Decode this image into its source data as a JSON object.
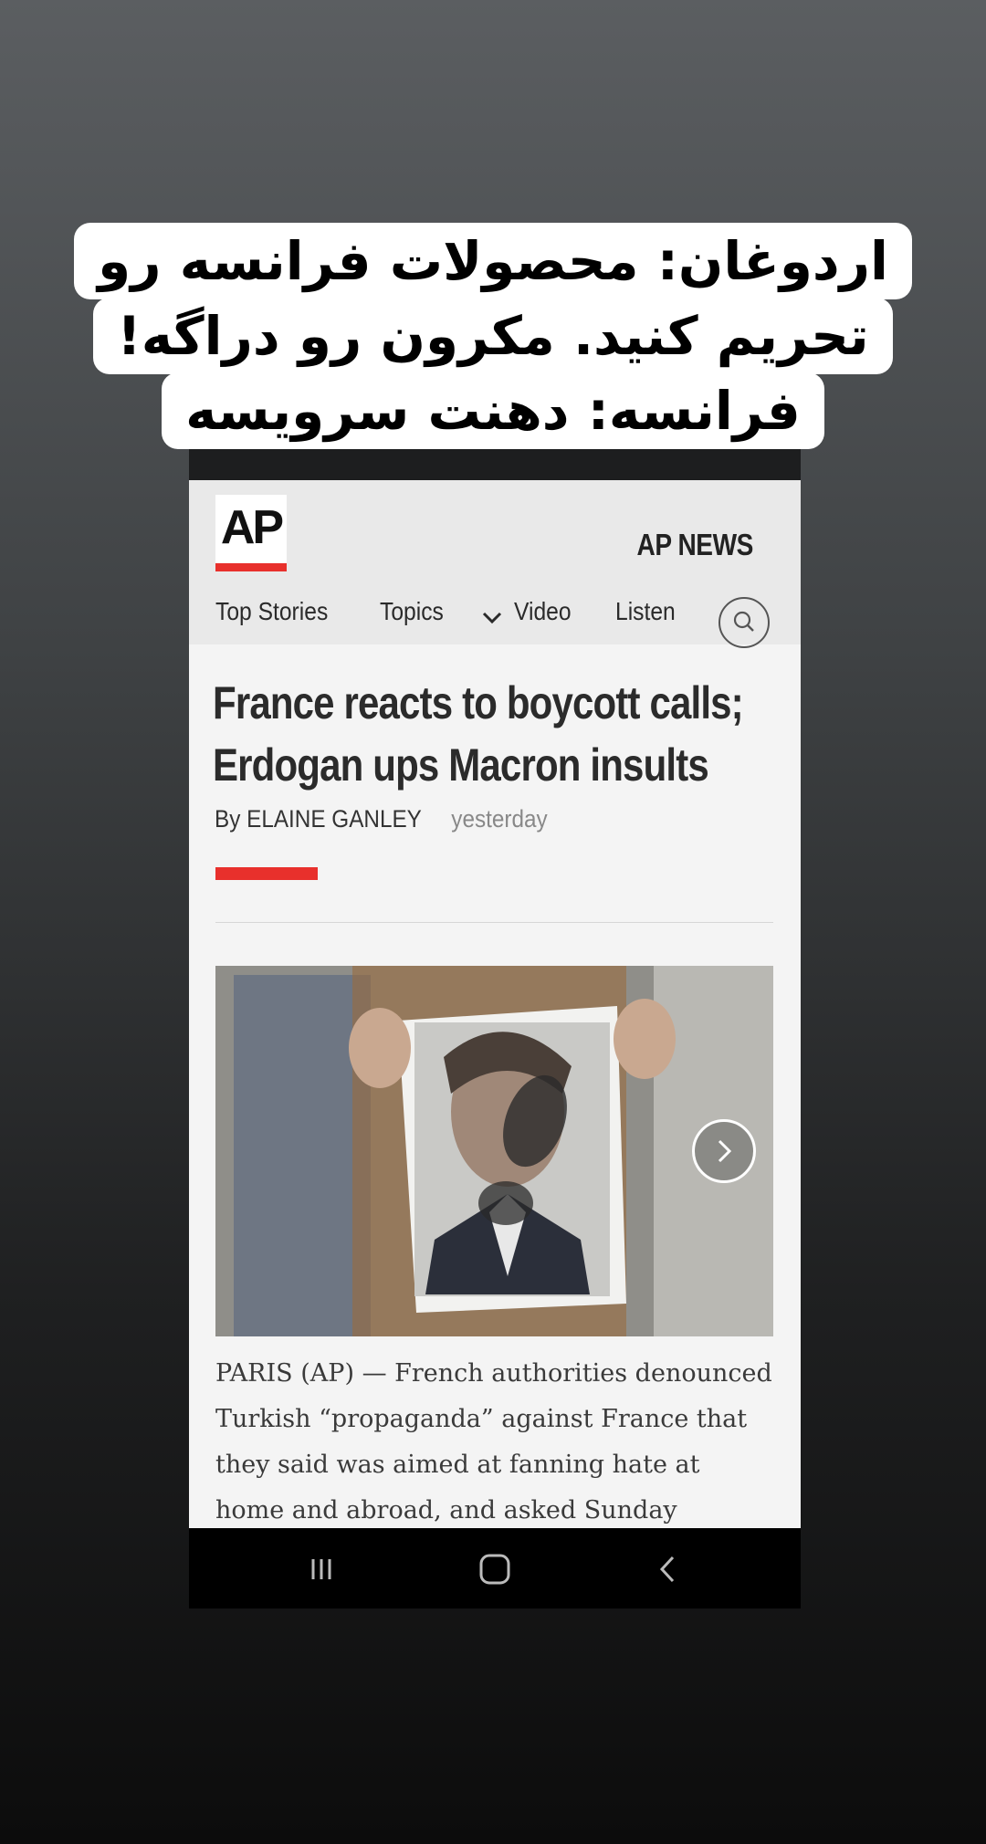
{
  "caption": {
    "lines": [
      "اردوغان: محصولات فرانسه رو",
      "تحریم کنید. مکرون رو دراگه!",
      "فرانسه: دهنت سرویسه"
    ]
  },
  "header": {
    "logo_text": "AP",
    "brand": "AP NEWS"
  },
  "nav": {
    "items": [
      "Top Stories",
      "Topics",
      "Video",
      "Listen"
    ]
  },
  "article": {
    "headline": "France reacts to boycott calls; Erdogan ups Macron insults",
    "author": "By ELAINE GANLEY",
    "time": "yesterday",
    "body": "PARIS (AP) — French authorities denounced Turkish “propaganda” against France that they said was aimed at fanning hate at home and abroad, and asked Sunday"
  },
  "colors": {
    "accent_red": "#e8302c",
    "header_bg": "#e9e9e9",
    "page_bg": "#f4f4f4"
  },
  "icons": {
    "search": "search-icon",
    "chevron": "chevron-down-icon",
    "next": "chevron-right-icon",
    "recents": "recents-icon",
    "home": "home-icon",
    "back": "back-icon"
  }
}
